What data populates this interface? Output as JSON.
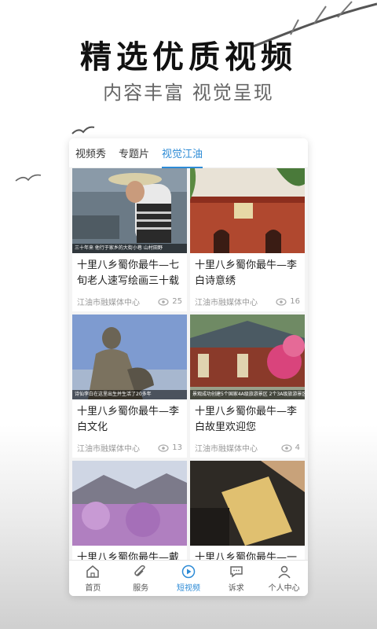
{
  "hero": {
    "title": "精选优质视频",
    "subtitle": "内容丰富 视觉呈现"
  },
  "tabs": [
    {
      "label": "视频秀"
    },
    {
      "label": "专题片"
    },
    {
      "label": "视觉江油",
      "active": true
    }
  ],
  "videos": [
    {
      "title": "十里八乡蜀你最牛—七旬老人速写绘画三十载 ...",
      "source": "江油市融媒体中心",
      "views": "25",
      "caption": "三十年来 他行于家乡的大街小巷 山村田野"
    },
    {
      "title": "十里八乡蜀你最牛—李白诗意绣",
      "source": "江油市融媒体中心",
      "views": "16",
      "caption": ""
    },
    {
      "title": "十里八乡蜀你最牛—李白文化",
      "source": "江油市融媒体中心",
      "views": "13",
      "caption": "诗仙李白在这里出生并生活了20多年"
    },
    {
      "title": "十里八乡蜀你最牛—李白故里欢迎您",
      "source": "江油市融媒体中心",
      "views": "4",
      "caption": "景观成功创建5个国家4A级旅游景区 2个3A级旅游景区"
    },
    {
      "title": "十里八乡蜀你最牛—戴天",
      "source": "",
      "views": "",
      "caption": ""
    },
    {
      "title": "十里八乡蜀你最牛—一把",
      "source": "",
      "views": "",
      "caption": ""
    }
  ],
  "nav": [
    {
      "label": "首页",
      "icon": "home-icon"
    },
    {
      "label": "服务",
      "icon": "service-icon"
    },
    {
      "label": "短视频",
      "icon": "play-icon",
      "active": true
    },
    {
      "label": "诉求",
      "icon": "chat-icon"
    },
    {
      "label": "个人中心",
      "icon": "user-icon"
    }
  ],
  "colors": {
    "accent": "#2d8bd6"
  }
}
